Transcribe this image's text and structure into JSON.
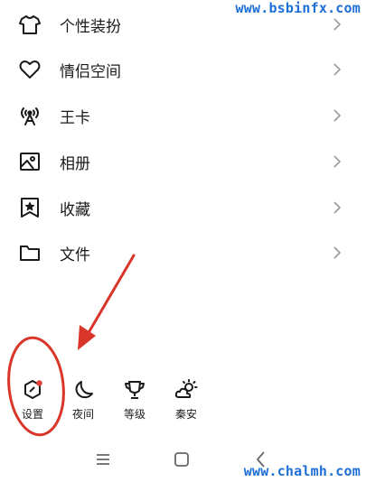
{
  "watermark": {
    "top": "www.bsbinfx.com",
    "bottom": "www.chalmh.com"
  },
  "menu": {
    "items": [
      {
        "label": "个性装扮",
        "icon": "tshirt-icon"
      },
      {
        "label": "情侣空间",
        "icon": "heart-icon"
      },
      {
        "label": "王卡",
        "icon": "signal-tower-icon"
      },
      {
        "label": "相册",
        "icon": "photo-album-icon"
      },
      {
        "label": "收藏",
        "icon": "bookmark-star-icon"
      },
      {
        "label": "文件",
        "icon": "folder-icon"
      }
    ]
  },
  "bottom_bar": {
    "items": [
      {
        "label": "设置",
        "icon": "settings-hexagon-icon",
        "badge": true
      },
      {
        "label": "夜间",
        "icon": "moon-icon"
      },
      {
        "label": "等级",
        "icon": "trophy-icon"
      },
      {
        "label": "秦安",
        "icon": "weather-sun-cloud-icon"
      }
    ]
  },
  "nav": {
    "icons": [
      "menu-lines-icon",
      "home-square-icon",
      "back-chevron-icon"
    ]
  },
  "colors": {
    "annotation_red": "#d9352a",
    "badge_red": "#e0403a",
    "icon_dark": "#1a1a1a",
    "chevron_gray": "#9a9a9a",
    "watermark_blue": "#1d6fd8"
  }
}
